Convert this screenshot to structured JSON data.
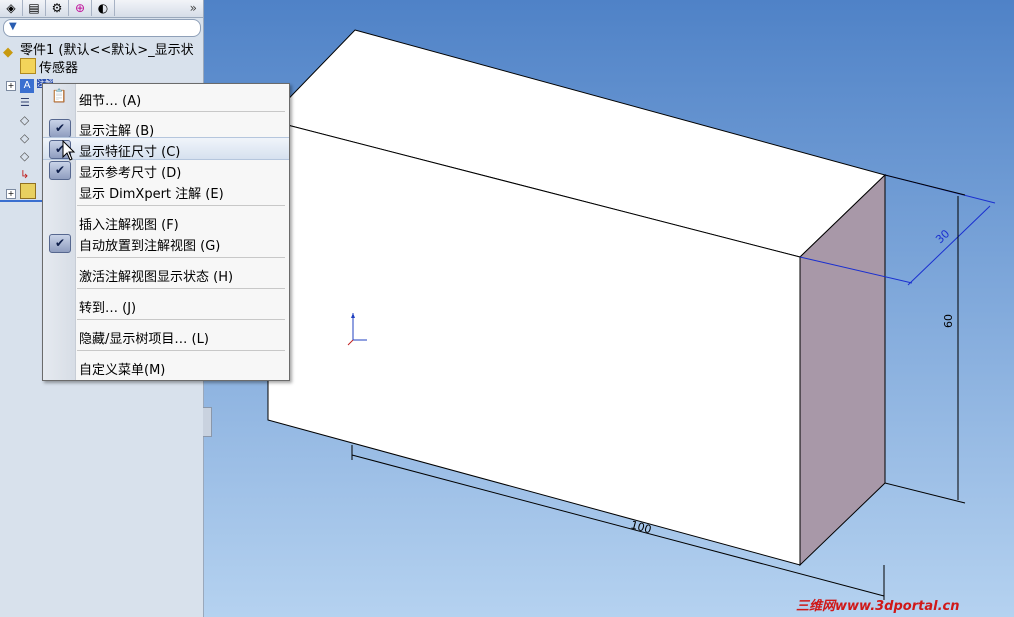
{
  "feature_tree": {
    "tabs": [
      "feature-manager-icon",
      "property-manager-icon",
      "configuration-manager-icon",
      "dimxpert-icon",
      "display-manager-icon"
    ],
    "more_tabs_chevron": "»",
    "root_label": "零件1 (默认<<默认>_显示状",
    "items": [
      {
        "label": "传感器",
        "icon": "sensor-folder-icon"
      },
      {
        "label": "注解",
        "icon": "annotations-icon"
      },
      {
        "label": "",
        "icon": "material-icon"
      },
      {
        "label": "",
        "icon": "plane-icon"
      },
      {
        "label": "",
        "icon": "plane-icon"
      },
      {
        "label": "",
        "icon": "plane-icon"
      },
      {
        "label": "",
        "icon": "origin-icon"
      },
      {
        "label": "",
        "icon": "extrude-feature-icon"
      }
    ]
  },
  "context_menu": {
    "items": [
      {
        "label": "细节… (A)",
        "checked": false,
        "icon": "properties-icon",
        "hover": false
      },
      {
        "label": "显示注解 (B)",
        "checked": true,
        "hover": false
      },
      {
        "label": "显示特征尺寸 (C)",
        "checked": true,
        "hover": true
      },
      {
        "label": "显示参考尺寸 (D)",
        "checked": true,
        "hover": false
      },
      {
        "label": "显示 DimXpert 注解 (E)",
        "checked": false,
        "hover": false
      },
      {
        "label": "插入注解视图 (F)",
        "checked": false,
        "hover": false
      },
      {
        "label": "自动放置到注解视图 (G)",
        "checked": true,
        "hover": false
      },
      {
        "label": "激活注解视图显示状态 (H)",
        "checked": false,
        "hover": false
      },
      {
        "label": "转到… (J)",
        "checked": false,
        "hover": false
      },
      {
        "label": "隐藏/显示树项目… (L)",
        "checked": false,
        "hover": false
      },
      {
        "label": "自定义菜单(M)",
        "checked": false,
        "hover": false
      }
    ],
    "check_glyph": "✔"
  },
  "graphics": {
    "dimensions": {
      "width": "100",
      "height": "60",
      "depth": "30"
    },
    "colors": {
      "bg_top": "#4f82c7",
      "bg_bottom": "#b5d2f0",
      "face_front": "#ffffff",
      "face_side": "#a898a8",
      "edge": "#000000",
      "dim_selected": "#1a2fd0",
      "triad_x": "#2040c0",
      "triad_y": "#2040c0"
    }
  },
  "watermark": {
    "text": "三维网www.3dportal.cn",
    "color": "#d01818"
  }
}
